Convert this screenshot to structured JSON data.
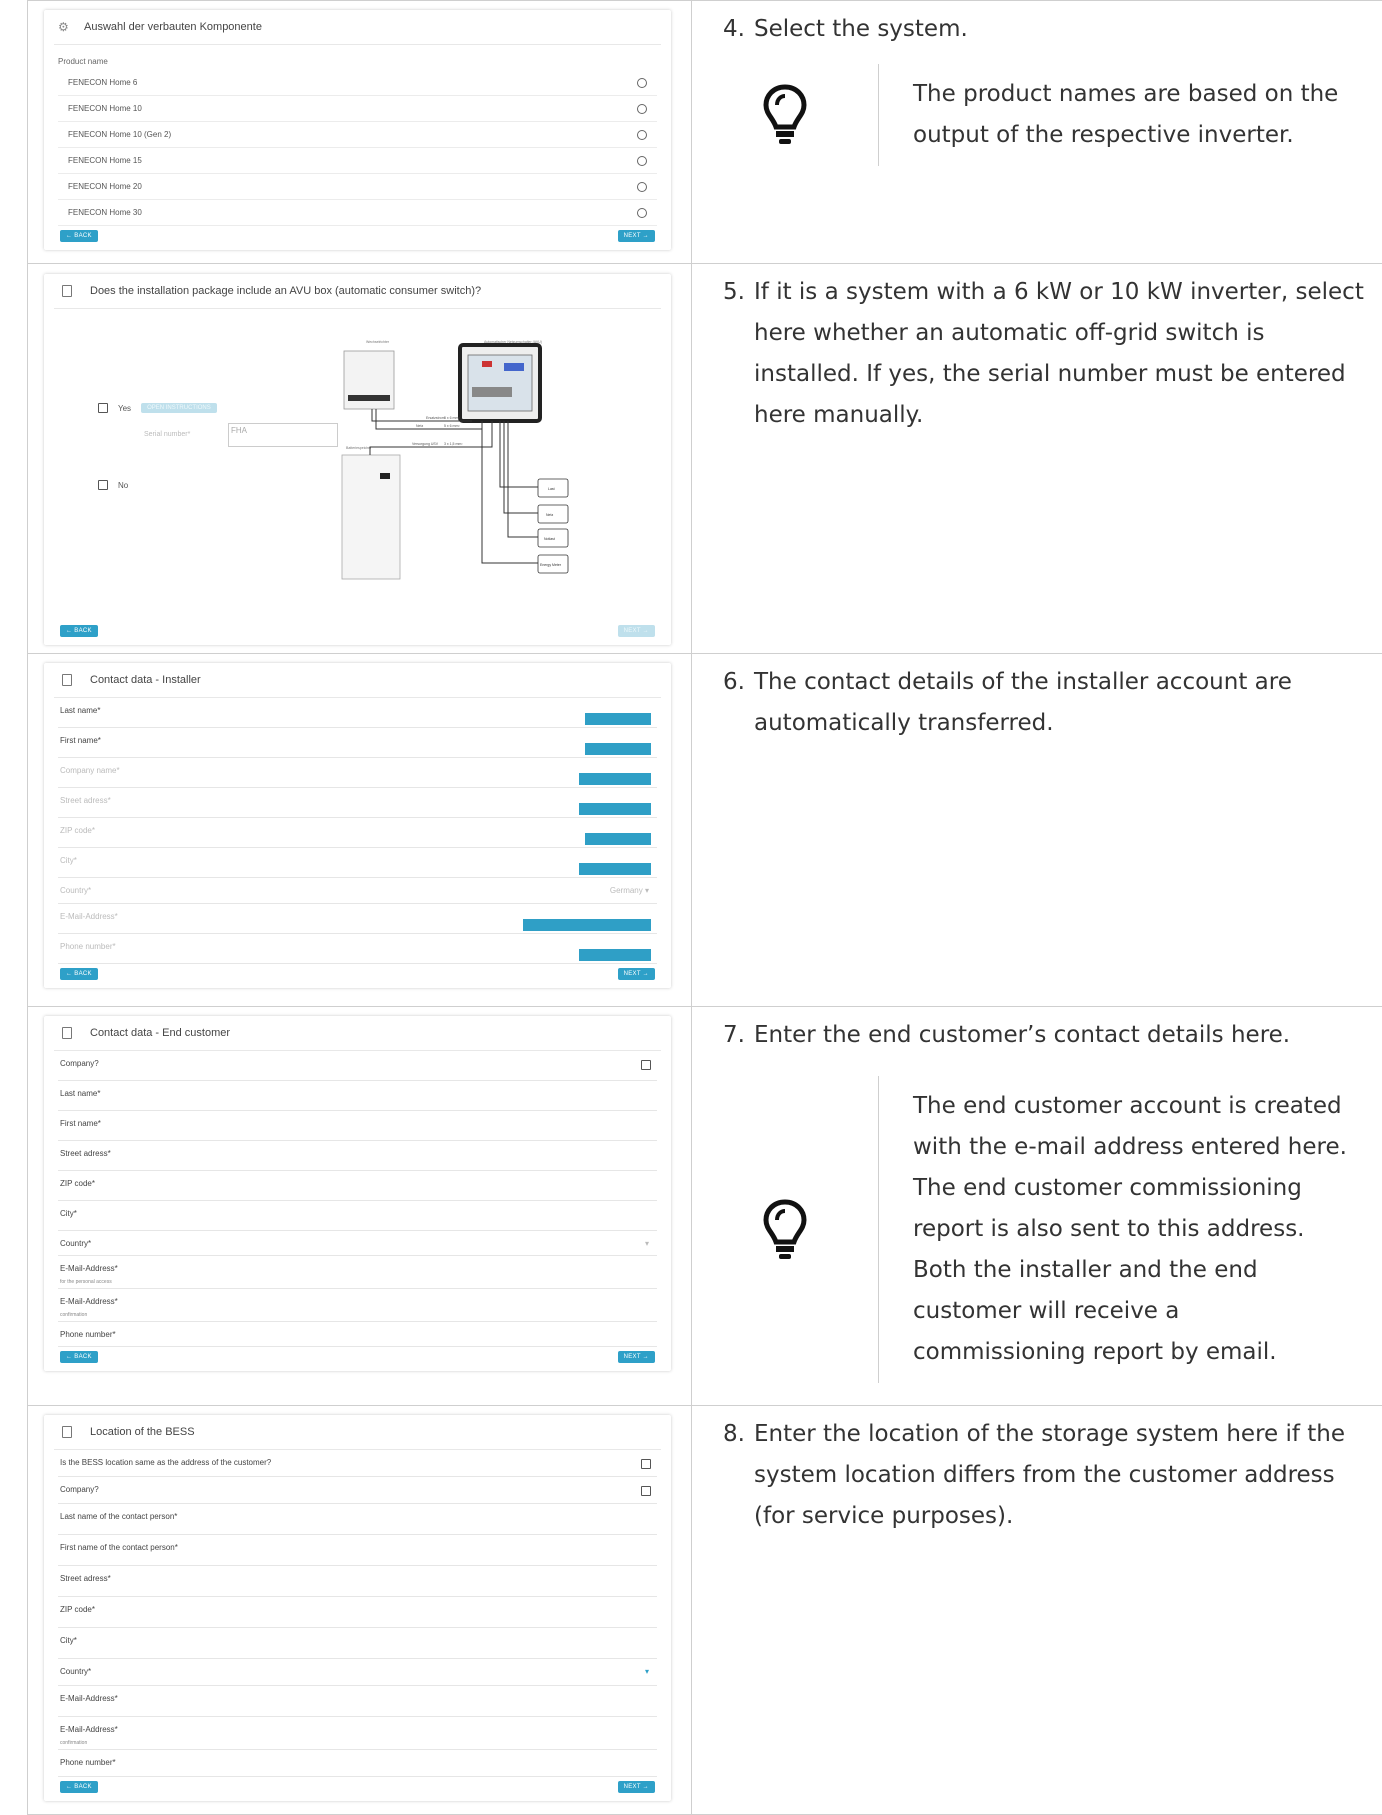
{
  "rows": [
    {
      "shot": {
        "title": "Auswahl der verbauten Komponente",
        "product_label": "Product name",
        "products": [
          "FENECON Home 6",
          "FENECON Home 10",
          "FENECON Home 10 (Gen 2)",
          "FENECON Home 15",
          "FENECON Home 20",
          "FENECON Home 30"
        ],
        "back": "← BACK",
        "next": "NEXT →"
      },
      "step": {
        "num": "4.",
        "text": "Select the system."
      },
      "tip": "The product names are based on the output of the respective inverter."
    },
    {
      "shot": {
        "title": "Does the installation package include an AVU box (automatic consumer switch)?",
        "yes": "Yes",
        "open_instructions": "OPEN INSTRUCTIONS",
        "serial_label": "Serial number*",
        "serial_value": "FHA",
        "no": "No",
        "diagram": {
          "inverter_label": "Wechselrichter",
          "avu_label": "Automatischer Netzumschalter (AVU)",
          "battery_label": "Batteriespeicher",
          "lines": [
            {
              "name": "Ersatzstrom",
              "spec": "5 x 6 mm²"
            },
            {
              "name": "Netz",
              "spec": "5 x 6 mm²"
            },
            {
              "name": "Versorgung USV",
              "spec": "3 x 1,5 mm²"
            }
          ],
          "outputs": [
            "Last",
            "Netz",
            "Notlast",
            "Energy Meter"
          ]
        },
        "back": "← BACK",
        "next": "NEXT →"
      },
      "step": {
        "num": "5.",
        "text": "If it is a system with a 6 kW or 10 kW inverter, select here whether an automatic off-grid switch is installed. If yes, the serial number must be entered here manually."
      }
    },
    {
      "shot": {
        "title": "Contact data - Installer",
        "fields": [
          {
            "label": "Last name*",
            "faded": false
          },
          {
            "label": "First name*",
            "faded": false
          },
          {
            "label": "Company name*",
            "faded": true
          },
          {
            "label": "Street adress*",
            "faded": true
          },
          {
            "label": "ZIP code*",
            "faded": true
          },
          {
            "label": "City*",
            "faded": true
          },
          {
            "label": "Country*",
            "faded": true,
            "select": "Germany ▾"
          },
          {
            "label": "E-Mail-Address*",
            "faded": true
          },
          {
            "label": "Phone number*",
            "faded": true
          }
        ],
        "back": "← BACK",
        "next": "NEXT →"
      },
      "step": {
        "num": "6.",
        "text": "The contact details of the installer account are automatically transferred."
      }
    },
    {
      "shot": {
        "title": "Contact data - End customer",
        "fields": [
          {
            "label": "Company?",
            "checkbox": true
          },
          {
            "label": "Last name*"
          },
          {
            "label": "First name*"
          },
          {
            "label": "Street adress*"
          },
          {
            "label": "ZIP code*"
          },
          {
            "label": "City*"
          },
          {
            "label": "Country*",
            "select": "▾"
          },
          {
            "label": "E-Mail-Address*",
            "sub": "for the personal access"
          },
          {
            "label": "E-Mail-Address*",
            "sub": "confirmation"
          },
          {
            "label": "Phone number*"
          }
        ],
        "back": "← BACK",
        "next": "NEXT →"
      },
      "step": {
        "num": "7.",
        "text": "Enter the end customer’s contact details here."
      },
      "tip": "The end customer account is created with the e-mail address entered here. The end customer commissioning report is also sent to this address. Both the installer and the end customer will receive a commissioning report by email."
    },
    {
      "shot": {
        "title": "Location of the BESS",
        "fields": [
          {
            "label": "Is the BESS location same as the address of the customer?",
            "checkbox": true
          },
          {
            "label": "Company?",
            "checkbox": true
          },
          {
            "label": "Last name of the contact person*"
          },
          {
            "label": "First name of the contact person*"
          },
          {
            "label": "Street adress*"
          },
          {
            "label": "ZIP code*"
          },
          {
            "label": "City*"
          },
          {
            "label": "Country*",
            "select": "▾"
          },
          {
            "label": "E-Mail-Address*"
          },
          {
            "label": "E-Mail-Address*",
            "sub": "confirmation"
          },
          {
            "label": "Phone number*"
          }
        ],
        "back": "← BACK",
        "next": "NEXT →"
      },
      "step": {
        "num": "8.",
        "text": "Enter the location of the storage system here if the system location differs from the customer address (for service purposes)."
      }
    }
  ]
}
